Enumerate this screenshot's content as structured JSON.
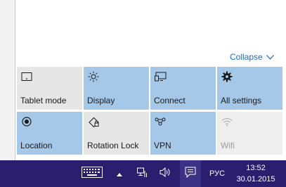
{
  "action_center": {
    "collapse_label": "Collapse",
    "accent_color": "#1b6ac9",
    "tiles": [
      {
        "label": "Tablet mode",
        "icon": "tablet-mode-icon",
        "state": "off"
      },
      {
        "label": "Display",
        "icon": "display-brightness-icon",
        "state": "on"
      },
      {
        "label": "Connect",
        "icon": "connect-icon",
        "state": "on"
      },
      {
        "label": "All settings",
        "icon": "gear-icon",
        "state": "on"
      },
      {
        "label": "Location",
        "icon": "location-icon",
        "state": "on"
      },
      {
        "label": "Rotation Lock",
        "icon": "rotation-lock-icon",
        "state": "off"
      },
      {
        "label": "VPN",
        "icon": "vpn-icon",
        "state": "on"
      },
      {
        "label": "Wifi",
        "icon": "wifi-icon",
        "state": "disabled"
      }
    ]
  },
  "taskbar": {
    "background": "#2b1e6e",
    "tray": {
      "keyboard_icon": "touch-keyboard-icon",
      "chevron_icon": "show-hidden-icons-chevron",
      "network_icon": "network-icon",
      "volume_icon": "volume-icon",
      "action_center_icon": "action-center-icon",
      "language": "РУС"
    },
    "clock": {
      "time": "13:52",
      "date": "30.01.2015"
    }
  }
}
